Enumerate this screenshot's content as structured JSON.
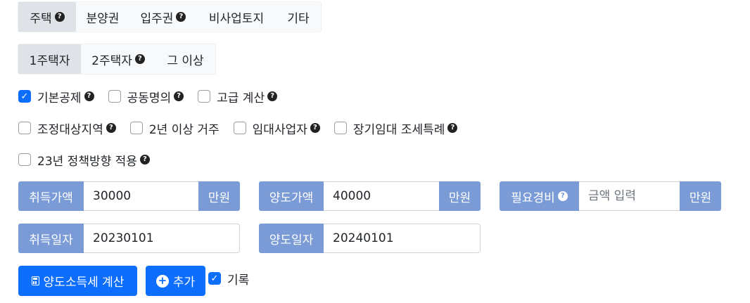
{
  "property_tabs": [
    {
      "label": "주택",
      "help": true,
      "active": true
    },
    {
      "label": "분양권",
      "help": false,
      "active": false
    },
    {
      "label": "입주권",
      "help": true,
      "active": false
    },
    {
      "label": "비사업토지",
      "help": false,
      "active": false
    },
    {
      "label": "기타",
      "help": false,
      "active": false
    }
  ],
  "house_count_tabs": [
    {
      "label": "1주택자",
      "help": false,
      "active": true
    },
    {
      "label": "2주택자",
      "help": true,
      "active": false
    },
    {
      "label": "그 이상",
      "help": false,
      "active": false
    }
  ],
  "options_row1": [
    {
      "label": "기본공제",
      "help": true,
      "checked": true
    },
    {
      "label": "공동명의",
      "help": true,
      "checked": false
    },
    {
      "label": "고급 계산",
      "help": true,
      "checked": false
    }
  ],
  "options_row2": [
    {
      "label": "조정대상지역",
      "help": true,
      "checked": false
    },
    {
      "label": "2년 이상 거주",
      "help": false,
      "checked": false
    },
    {
      "label": "임대사업자",
      "help": true,
      "checked": false
    },
    {
      "label": "장기임대 조세특례",
      "help": true,
      "checked": false
    }
  ],
  "options_row3": [
    {
      "label": "23년 정책방향 적용",
      "help": true,
      "checked": false
    }
  ],
  "help_glyph": "?",
  "check_glyph": "✓",
  "acquisition_price": {
    "label": "취득가액",
    "value": "30000",
    "unit": "만원"
  },
  "transfer_price": {
    "label": "양도가액",
    "value": "40000",
    "unit": "만원"
  },
  "necessary_expense": {
    "label": "필요경비",
    "placeholder": "금액 입력",
    "unit": "만원"
  },
  "acquisition_date": {
    "label": "취득일자",
    "value": "20230101"
  },
  "transfer_date": {
    "label": "양도일자",
    "value": "20240101"
  },
  "calculate_button": {
    "label": "양도소득세 계산"
  },
  "add_button": {
    "label": "추가",
    "glyph": "+"
  },
  "record_checkbox": {
    "label": "기록",
    "checked": true
  },
  "colors": {
    "primary": "#0d6efd",
    "label_bg": "#7a9bd6",
    "active_tab": "#dfe3e7"
  }
}
